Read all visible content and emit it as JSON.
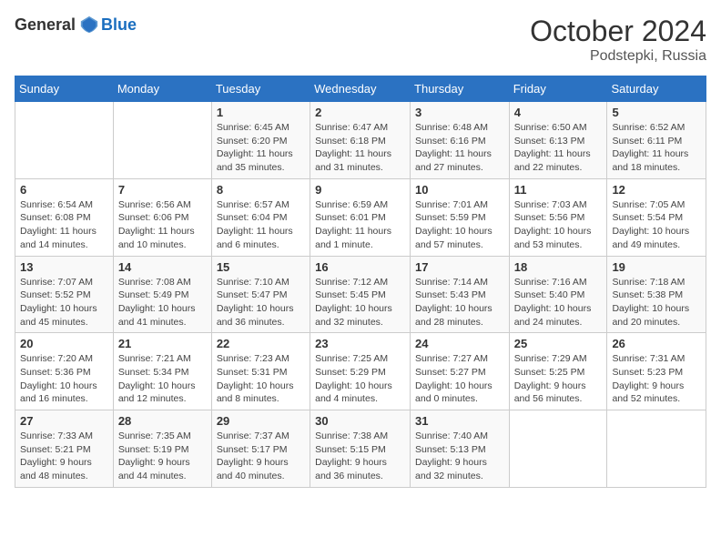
{
  "header": {
    "logo_general": "General",
    "logo_blue": "Blue",
    "month": "October 2024",
    "location": "Podstepki, Russia"
  },
  "weekdays": [
    "Sunday",
    "Monday",
    "Tuesday",
    "Wednesday",
    "Thursday",
    "Friday",
    "Saturday"
  ],
  "weeks": [
    [
      {
        "day": "",
        "info": ""
      },
      {
        "day": "",
        "info": ""
      },
      {
        "day": "1",
        "info": "Sunrise: 6:45 AM\nSunset: 6:20 PM\nDaylight: 11 hours and 35 minutes."
      },
      {
        "day": "2",
        "info": "Sunrise: 6:47 AM\nSunset: 6:18 PM\nDaylight: 11 hours and 31 minutes."
      },
      {
        "day": "3",
        "info": "Sunrise: 6:48 AM\nSunset: 6:16 PM\nDaylight: 11 hours and 27 minutes."
      },
      {
        "day": "4",
        "info": "Sunrise: 6:50 AM\nSunset: 6:13 PM\nDaylight: 11 hours and 22 minutes."
      },
      {
        "day": "5",
        "info": "Sunrise: 6:52 AM\nSunset: 6:11 PM\nDaylight: 11 hours and 18 minutes."
      }
    ],
    [
      {
        "day": "6",
        "info": "Sunrise: 6:54 AM\nSunset: 6:08 PM\nDaylight: 11 hours and 14 minutes."
      },
      {
        "day": "7",
        "info": "Sunrise: 6:56 AM\nSunset: 6:06 PM\nDaylight: 11 hours and 10 minutes."
      },
      {
        "day": "8",
        "info": "Sunrise: 6:57 AM\nSunset: 6:04 PM\nDaylight: 11 hours and 6 minutes."
      },
      {
        "day": "9",
        "info": "Sunrise: 6:59 AM\nSunset: 6:01 PM\nDaylight: 11 hours and 1 minute."
      },
      {
        "day": "10",
        "info": "Sunrise: 7:01 AM\nSunset: 5:59 PM\nDaylight: 10 hours and 57 minutes."
      },
      {
        "day": "11",
        "info": "Sunrise: 7:03 AM\nSunset: 5:56 PM\nDaylight: 10 hours and 53 minutes."
      },
      {
        "day": "12",
        "info": "Sunrise: 7:05 AM\nSunset: 5:54 PM\nDaylight: 10 hours and 49 minutes."
      }
    ],
    [
      {
        "day": "13",
        "info": "Sunrise: 7:07 AM\nSunset: 5:52 PM\nDaylight: 10 hours and 45 minutes."
      },
      {
        "day": "14",
        "info": "Sunrise: 7:08 AM\nSunset: 5:49 PM\nDaylight: 10 hours and 41 minutes."
      },
      {
        "day": "15",
        "info": "Sunrise: 7:10 AM\nSunset: 5:47 PM\nDaylight: 10 hours and 36 minutes."
      },
      {
        "day": "16",
        "info": "Sunrise: 7:12 AM\nSunset: 5:45 PM\nDaylight: 10 hours and 32 minutes."
      },
      {
        "day": "17",
        "info": "Sunrise: 7:14 AM\nSunset: 5:43 PM\nDaylight: 10 hours and 28 minutes."
      },
      {
        "day": "18",
        "info": "Sunrise: 7:16 AM\nSunset: 5:40 PM\nDaylight: 10 hours and 24 minutes."
      },
      {
        "day": "19",
        "info": "Sunrise: 7:18 AM\nSunset: 5:38 PM\nDaylight: 10 hours and 20 minutes."
      }
    ],
    [
      {
        "day": "20",
        "info": "Sunrise: 7:20 AM\nSunset: 5:36 PM\nDaylight: 10 hours and 16 minutes."
      },
      {
        "day": "21",
        "info": "Sunrise: 7:21 AM\nSunset: 5:34 PM\nDaylight: 10 hours and 12 minutes."
      },
      {
        "day": "22",
        "info": "Sunrise: 7:23 AM\nSunset: 5:31 PM\nDaylight: 10 hours and 8 minutes."
      },
      {
        "day": "23",
        "info": "Sunrise: 7:25 AM\nSunset: 5:29 PM\nDaylight: 10 hours and 4 minutes."
      },
      {
        "day": "24",
        "info": "Sunrise: 7:27 AM\nSunset: 5:27 PM\nDaylight: 10 hours and 0 minutes."
      },
      {
        "day": "25",
        "info": "Sunrise: 7:29 AM\nSunset: 5:25 PM\nDaylight: 9 hours and 56 minutes."
      },
      {
        "day": "26",
        "info": "Sunrise: 7:31 AM\nSunset: 5:23 PM\nDaylight: 9 hours and 52 minutes."
      }
    ],
    [
      {
        "day": "27",
        "info": "Sunrise: 7:33 AM\nSunset: 5:21 PM\nDaylight: 9 hours and 48 minutes."
      },
      {
        "day": "28",
        "info": "Sunrise: 7:35 AM\nSunset: 5:19 PM\nDaylight: 9 hours and 44 minutes."
      },
      {
        "day": "29",
        "info": "Sunrise: 7:37 AM\nSunset: 5:17 PM\nDaylight: 9 hours and 40 minutes."
      },
      {
        "day": "30",
        "info": "Sunrise: 7:38 AM\nSunset: 5:15 PM\nDaylight: 9 hours and 36 minutes."
      },
      {
        "day": "31",
        "info": "Sunrise: 7:40 AM\nSunset: 5:13 PM\nDaylight: 9 hours and 32 minutes."
      },
      {
        "day": "",
        "info": ""
      },
      {
        "day": "",
        "info": ""
      }
    ]
  ]
}
